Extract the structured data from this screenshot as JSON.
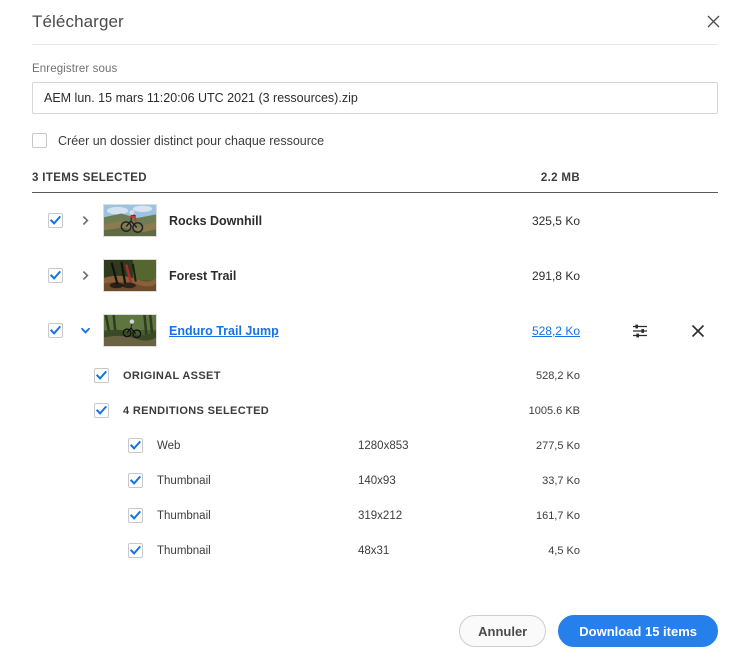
{
  "dialog": {
    "title": "Télécharger",
    "close_icon": "close-icon"
  },
  "form": {
    "save_as_label": "Enregistrer sous",
    "filename_value": "AEM lun. 15 mars 11:20:06 UTC 2021 (3 ressources).zip",
    "filename_placeholder": "Enregistrer sous",
    "separate_folder_label": "Créer un dossier distinct pour chaque ressource",
    "separate_folder_checked": false
  },
  "summary": {
    "items_selected": "3 ITEMS SELECTED",
    "total_size": "2.2 MB"
  },
  "assets": [
    {
      "name": "Rocks Downhill",
      "size": "325,5 Ko",
      "checked": true,
      "expanded": false,
      "hovered": false,
      "thumb_alt": "mountain-biker-on-rocky-ridge"
    },
    {
      "name": "Forest Trail",
      "size": "291,8 Ko",
      "checked": true,
      "expanded": false,
      "hovered": false,
      "thumb_alt": "bike-wheels-on-forest-dirt"
    },
    {
      "name": "Enduro Trail Jump",
      "size": "528,2 Ko",
      "checked": true,
      "expanded": true,
      "hovered": true,
      "thumb_alt": "rider-jumping-in-green-forest",
      "actions": {
        "settings_icon": "sliders-settings-icon",
        "remove_icon": "close-icon"
      },
      "children": [
        {
          "label": "ORIGINAL ASSET",
          "size": "528,2 Ko",
          "dims": "",
          "checked": true,
          "level": 1
        },
        {
          "label": "4 RENDITIONS SELECTED",
          "size": "1005.6  KB",
          "dims": "",
          "checked": true,
          "level": 1
        },
        {
          "label": "Web",
          "dims": "1280x853",
          "size": "277,5 Ko",
          "checked": true,
          "level": 2
        },
        {
          "label": "Thumbnail",
          "dims": "140x93",
          "size": "33,7 Ko",
          "checked": true,
          "level": 2
        },
        {
          "label": "Thumbnail",
          "dims": "319x212",
          "size": "161,7 Ko",
          "checked": true,
          "level": 2
        },
        {
          "label": "Thumbnail",
          "dims": "48x31",
          "size": "4,5 Ko",
          "checked": true,
          "level": 2
        }
      ]
    }
  ],
  "footer": {
    "cancel_label": "Annuler",
    "download_label": "Download 15 items"
  },
  "colors": {
    "accent": "#2680eb",
    "check": "#1473e6",
    "text": "#2c2c2c",
    "muted": "#707070",
    "rule": "#5a5a5a"
  }
}
